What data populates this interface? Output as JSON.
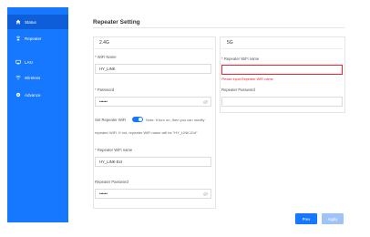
{
  "sidebar": {
    "items": [
      {
        "label": "Status",
        "icon": "home-icon",
        "active": true
      },
      {
        "label": "Repeater",
        "icon": "repeater-icon",
        "active": false
      },
      {
        "label": "LAN",
        "icon": "lan-icon",
        "active": false
      },
      {
        "label": "Wireless",
        "icon": "wifi-icon",
        "active": false
      },
      {
        "label": "Advance",
        "icon": "gear-icon",
        "active": false
      }
    ]
  },
  "page": {
    "title": "Repeater Setting"
  },
  "band24": {
    "header": "2.4G",
    "wifi_name_label": "WiFi Name",
    "wifi_name_value": "HY_LINK",
    "password_label": "Password",
    "password_value": "••••••",
    "set_repeater_label": "Set Repeater WiFi",
    "set_repeater_note": "Note: If turn on, then you can modify",
    "set_repeater_note2": "repeater WiFi. If not, repeater WiFi name will be \"HY_LINK-Ext\"",
    "repeater_name_label": "Repeater WiFi name",
    "repeater_name_value": "HY_LINK-Ext",
    "repeater_password_label": "Repeater Password",
    "repeater_password_value": "••••••"
  },
  "band5": {
    "header": "5G",
    "repeater_name_label": "Repeater WiFi name",
    "repeater_name_value": "",
    "repeater_name_error": "Please input Repeater WiFi name",
    "repeater_password_label": "Repeater Password",
    "repeater_password_value": ""
  },
  "buttons": {
    "prev": "Prev",
    "apply": "Apply"
  },
  "colors": {
    "accent": "#1677ff",
    "error": "#f5222d",
    "apply_disabled": "#9fc3f7"
  }
}
